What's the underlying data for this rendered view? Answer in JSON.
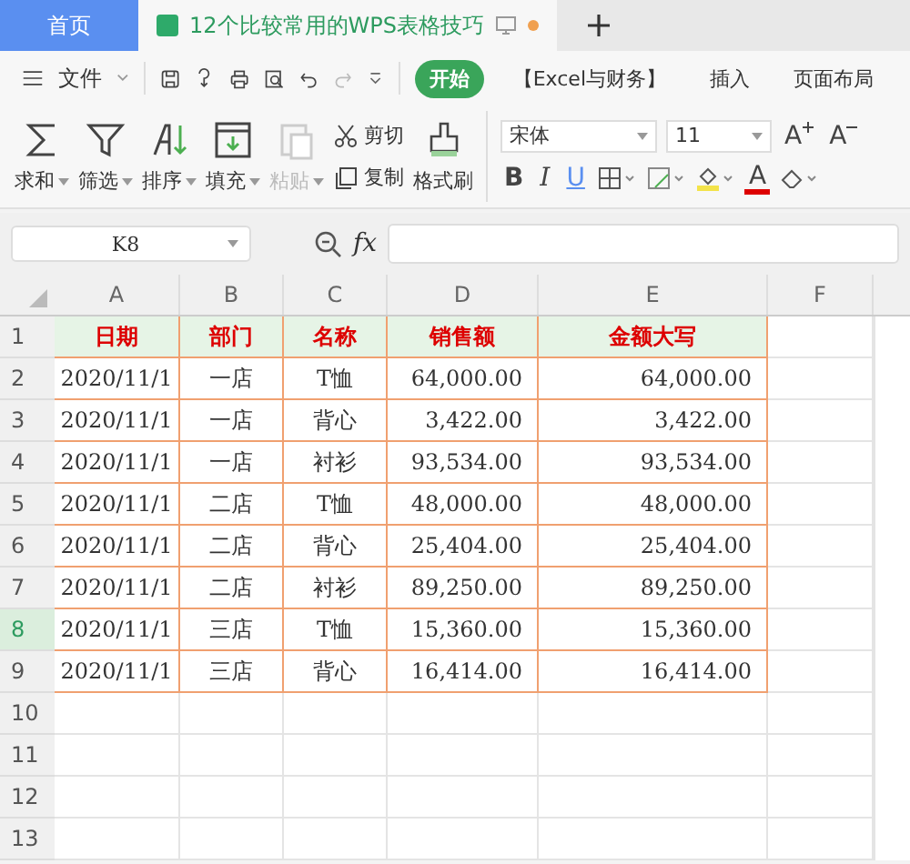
{
  "tabs": [
    {
      "label": "首页",
      "kind": "home",
      "selected": false
    },
    {
      "label": "12个比较常用的WPS表格技巧",
      "kind": "doc",
      "selected": true
    }
  ],
  "menu": {
    "file": "文件",
    "items": [
      {
        "label": "开始",
        "selected": true
      },
      {
        "label": "【Excel与财务】",
        "selected": false
      },
      {
        "label": "插入",
        "selected": false
      },
      {
        "label": "页面布局",
        "selected": false
      }
    ]
  },
  "ribbon": {
    "big_buttons": [
      {
        "label": "求和",
        "kind": "sum",
        "disabled": false
      },
      {
        "label": "筛选",
        "kind": "filter",
        "disabled": false
      },
      {
        "label": "排序",
        "kind": "sort",
        "disabled": false
      },
      {
        "label": "填充",
        "kind": "fill",
        "disabled": false
      },
      {
        "label": "粘贴",
        "kind": "paste",
        "disabled": true
      }
    ],
    "cut": "剪切",
    "copy": "复制",
    "format_painter": "格式刷",
    "font": "宋体",
    "font_size": "11",
    "grow": "A",
    "shrink": "A",
    "bold": "B",
    "italic": "I",
    "underline": "U",
    "font_color": "A"
  },
  "name_box": "K8",
  "fx": "fx",
  "columns": [
    "A",
    "B",
    "C",
    "D",
    "E",
    "F"
  ],
  "rows": [
    {
      "num": "1",
      "selected": false,
      "cells": [
        "日期",
        "部门",
        "名称",
        "销售额",
        "金额大写"
      ],
      "kind": "header"
    },
    {
      "num": "2",
      "selected": false,
      "cells": [
        "2020/11/1",
        "一店",
        "T恤",
        "64,000.00",
        "64,000.00"
      ],
      "kind": "data"
    },
    {
      "num": "3",
      "selected": false,
      "cells": [
        "2020/11/1",
        "一店",
        "背心",
        "3,422.00",
        "3,422.00"
      ],
      "kind": "data"
    },
    {
      "num": "4",
      "selected": false,
      "cells": [
        "2020/11/1",
        "一店",
        "衬衫",
        "93,534.00",
        "93,534.00"
      ],
      "kind": "data"
    },
    {
      "num": "5",
      "selected": false,
      "cells": [
        "2020/11/1",
        "二店",
        "T恤",
        "48,000.00",
        "48,000.00"
      ],
      "kind": "data"
    },
    {
      "num": "6",
      "selected": false,
      "cells": [
        "2020/11/1",
        "二店",
        "背心",
        "25,404.00",
        "25,404.00"
      ],
      "kind": "data"
    },
    {
      "num": "7",
      "selected": false,
      "cells": [
        "2020/11/1",
        "二店",
        "衬衫",
        "89,250.00",
        "89,250.00"
      ],
      "kind": "data"
    },
    {
      "num": "8",
      "selected": true,
      "cells": [
        "2020/11/1",
        "三店",
        "T恤",
        "15,360.00",
        "15,360.00"
      ],
      "kind": "data"
    },
    {
      "num": "9",
      "selected": false,
      "cells": [
        "2020/11/1",
        "三店",
        "背心",
        "16,414.00",
        "16,414.00"
      ],
      "kind": "data"
    },
    {
      "num": "10",
      "selected": false,
      "cells": [],
      "kind": "empty"
    },
    {
      "num": "11",
      "selected": false,
      "cells": [],
      "kind": "empty"
    },
    {
      "num": "12",
      "selected": false,
      "cells": [],
      "kind": "empty"
    },
    {
      "num": "13",
      "selected": false,
      "cells": [],
      "kind": "empty"
    }
  ]
}
